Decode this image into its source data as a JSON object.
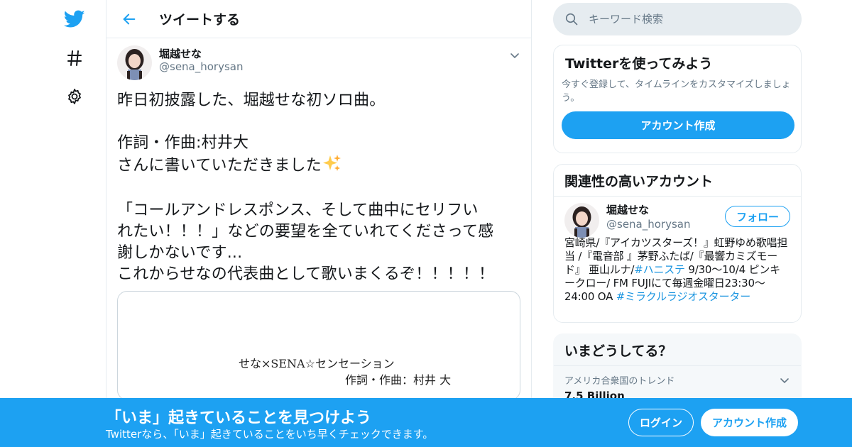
{
  "colors": {
    "brand_blue": "#1da1f2",
    "link_blue": "#1b95e0",
    "text_primary": "#14171a",
    "text_secondary": "#657786",
    "border": "#e6ecf0"
  },
  "nav": {
    "icons": [
      "twitter-bird-icon",
      "hashtag-icon",
      "gear-icon"
    ]
  },
  "header": {
    "title": "ツイートする"
  },
  "tweet": {
    "author_name": "堀越せな",
    "author_handle": "@sena_horysan",
    "text_lines": [
      "昨日初披露した、堀越せな初ソロ曲。",
      "",
      "作詞・作曲:村井大",
      "さんに書いていただきました"
    ],
    "text_lines2": [
      "",
      "「コールアンドレスポンス、そして曲中にセリフい",
      "れたい！！！」などの要望を全ていれてくださって感",
      "謝しかないです...",
      "これからせなの代表曲として歌いまくるぞ！！！！！"
    ],
    "sparkle_emoji": "✨",
    "media": {
      "line1": "せな×SENA☆センセーション",
      "line2": "作詞・作曲：村井 大"
    }
  },
  "search": {
    "placeholder": "キーワード検索"
  },
  "signup_panel": {
    "title": "Twitterを使ってみよう",
    "description": "今すぐ登録して、タイムラインをカスタマイズしましょう。",
    "button": "アカウント作成"
  },
  "related_panel": {
    "title": "関連性の高いアカウント",
    "user": {
      "name": "堀越せな",
      "handle": "@sena_horysan",
      "follow_button": "フォロー",
      "bio_part1": "宮崎県/『アイカツスターズ！』虹野ゆめ歌唱担当 /『電音部 』茅野ふたば/『最響カミズモード』 亜山ルナ/",
      "bio_hashtag1": "#ハニステ",
      "bio_part2": " 9/30〜10/4 ピンキークロー/ FM FUJIにて毎週金曜日23:30〜24:00 OA ",
      "bio_hashtag2": "#ミラクルラジオスターター"
    }
  },
  "trends_panel": {
    "title": "いまどうしてる？",
    "items": [
      {
        "meta": "アメリカ合衆国のトレンド",
        "name": "7.5 Billion"
      }
    ]
  },
  "bottom_bar": {
    "title": "「いま」起きていることを見つけよう",
    "subtitle": "Twitterなら、「いま」起きていることをいち早くチェックできます。",
    "login_button": "ログイン",
    "signup_button": "アカウント作成"
  }
}
